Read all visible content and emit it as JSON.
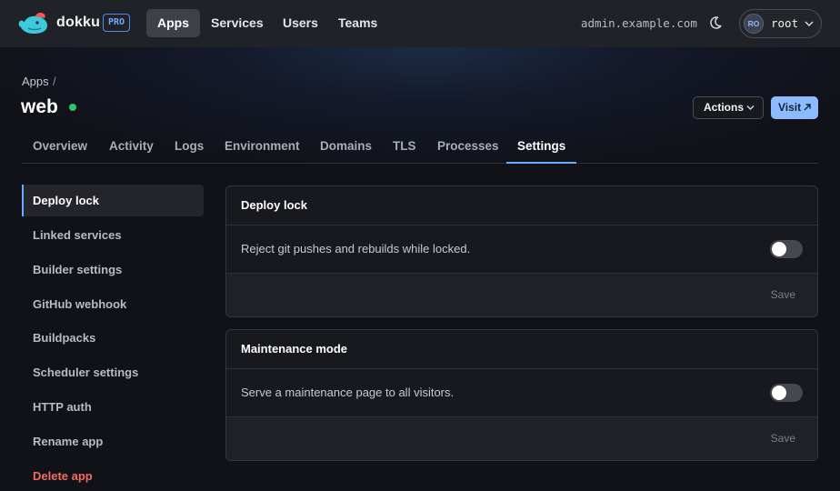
{
  "nav": {
    "brand": "dokku",
    "pro_badge": "PRO",
    "links": [
      "Apps",
      "Services",
      "Users",
      "Teams"
    ],
    "host": "admin.example.com",
    "user": {
      "initials": "RO",
      "name": "root"
    }
  },
  "header": {
    "breadcrumb": "Apps",
    "breadcrumb_sep": "/",
    "app_name": "web",
    "status": "running",
    "actions_label": "Actions",
    "visit_label": "Visit"
  },
  "tabs": [
    "Overview",
    "Activity",
    "Logs",
    "Environment",
    "Domains",
    "TLS",
    "Processes",
    "Settings"
  ],
  "active_tab": "Settings",
  "sidebar": {
    "items": [
      "Deploy lock",
      "Linked services",
      "Builder settings",
      "GitHub webhook",
      "Buildpacks",
      "Scheduler settings",
      "HTTP auth",
      "Rename app",
      "Delete app"
    ],
    "active": "Deploy lock"
  },
  "cards": [
    {
      "title": "Deploy lock",
      "description": "Reject git pushes and rebuilds while locked.",
      "enabled": false,
      "save_label": "Save"
    },
    {
      "title": "Maintenance mode",
      "description": "Serve a maintenance page to all visitors.",
      "enabled": false,
      "save_label": "Save"
    }
  ],
  "colors": {
    "accent": "#6ea8ff",
    "success": "#32c46d",
    "danger": "#f06d5f",
    "background": "#101217"
  }
}
